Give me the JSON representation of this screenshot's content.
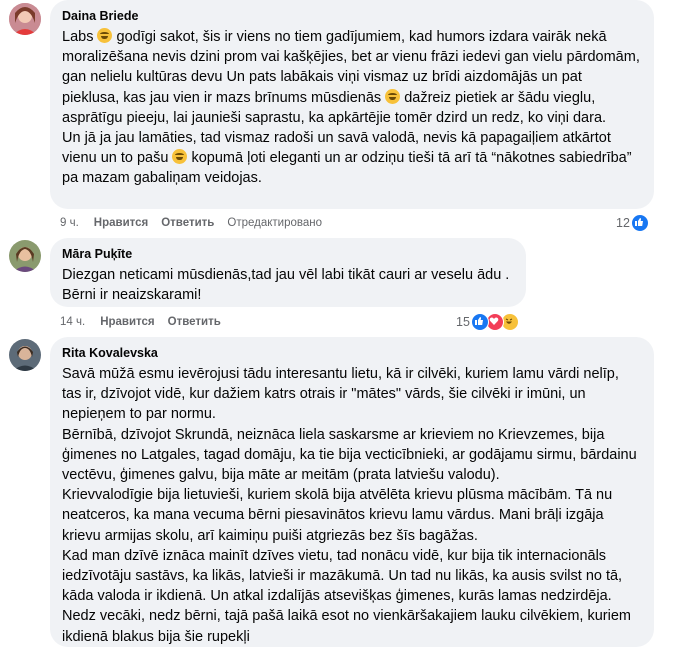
{
  "colors": {
    "like": "#1877f2",
    "love": "#f33e58",
    "haha": "#f7c13a",
    "bubble": "#f0f2f5"
  },
  "comments": [
    {
      "author": "Daina Briede",
      "paragraphs": [
        [
          "Labs ",
          "godīgi sakot, šis ir viens no tiem gadījumiem, kad humors izdara vairāk nekā moralizēšana nevis dzini prom vai kašķējies, bet ar vienu frāzi iedevi gan vielu pārdomām, gan nelielu kultūras devu Un pats labākais viņi vismaz uz brīdi aizdomājās un pat pieklusa, kas jau vien ir mazs brīnums mūsdienās ",
          "dažreiz pietiek ar šādu vieglu, asprātīgu pieeju, lai jaunieši saprastu, ka apkārtējie tomēr dzird un redz, ko viņi dara."
        ],
        [
          "Un jā ja jau lamāties, tad vismaz radoši un savā valodā, nevis kā papagaiļiem atkārtot vienu un to pašu ",
          "kopumā ļoti eleganti un ar odziņu tieši tā arī tā “nākotnes sabiedrība” pa mazam gabaliņam veidojas."
        ]
      ],
      "time": "9 ч.",
      "like": "Нравится",
      "reply": "Ответить",
      "edited": "Отредактировано",
      "reaction_count": "12",
      "reactions": [
        "like-icon"
      ]
    },
    {
      "author": "Māra Puķīte",
      "paragraphs": [
        [
          "Diezgan neticami mūsdienās,tad jau vēl labi tikāt cauri ar veselu ādu ."
        ],
        [
          "Bērni ir neaizskarami!"
        ]
      ],
      "time": "14 ч.",
      "like": "Нравится",
      "reply": "Ответить",
      "reaction_count": "15",
      "reactions": [
        "like-icon",
        "love-icon",
        "haha-icon"
      ]
    },
    {
      "author": "Rita Kovalevska",
      "paragraphs": [
        [
          "Savā mūžā esmu ievērojusi tādu interesantu lietu, kā ir cilvēki, kuriem lamu vārdi nelīp, tas ir, dzīvojot vidē, kur dažiem katrs otrais ir \"mātes\" vārds, šie cilvēki ir imūni, un nepieņem to par normu."
        ],
        [
          "Bērnībā, dzīvojot Skrundā, neiznāca liela saskarsme ar krieviem no Krievzemes, bija ģimenes no Latgales, tagad domāju, ka tie bija vecticībnieki, ar godājamu sirmu, bārdainu vectēvu, ģimenes galvu, bija māte ar meitām (prata latviešu valodu)."
        ],
        [
          "Krievvalodīgie bija lietuvieši, kuriem skolā bija atvēlēta krievu plūsma mācībām. Tā nu neatceros, ka mana vecuma bērni piesavinātos krievu lamu vārdus. Mani brāļi izgāja krievu armijas skolu, arī kaimiņu puiši atgriezās bez šīs bagāžas."
        ],
        [
          "Kad man dzīvē iznāca mainīt dzīves vietu, tad nonācu vidē, kur bija tik internacionāls iedzīvotāju sastāvs, ka likās, latvieši ir mazākumā. Un tad nu likās, ka ausis svilst no tā, kāda valoda ir ikdienā. Un atkal izdalījās atsevišķas ģimenes, kurās lamas nedzirdēja."
        ],
        [
          "Nedz vecāki, nedz bērni, tajā pašā laikā esot no vienkāršakajiem lauku cilvēkiem, kuriem ikdienā blakus bija šie rupekļi"
        ]
      ]
    }
  ]
}
